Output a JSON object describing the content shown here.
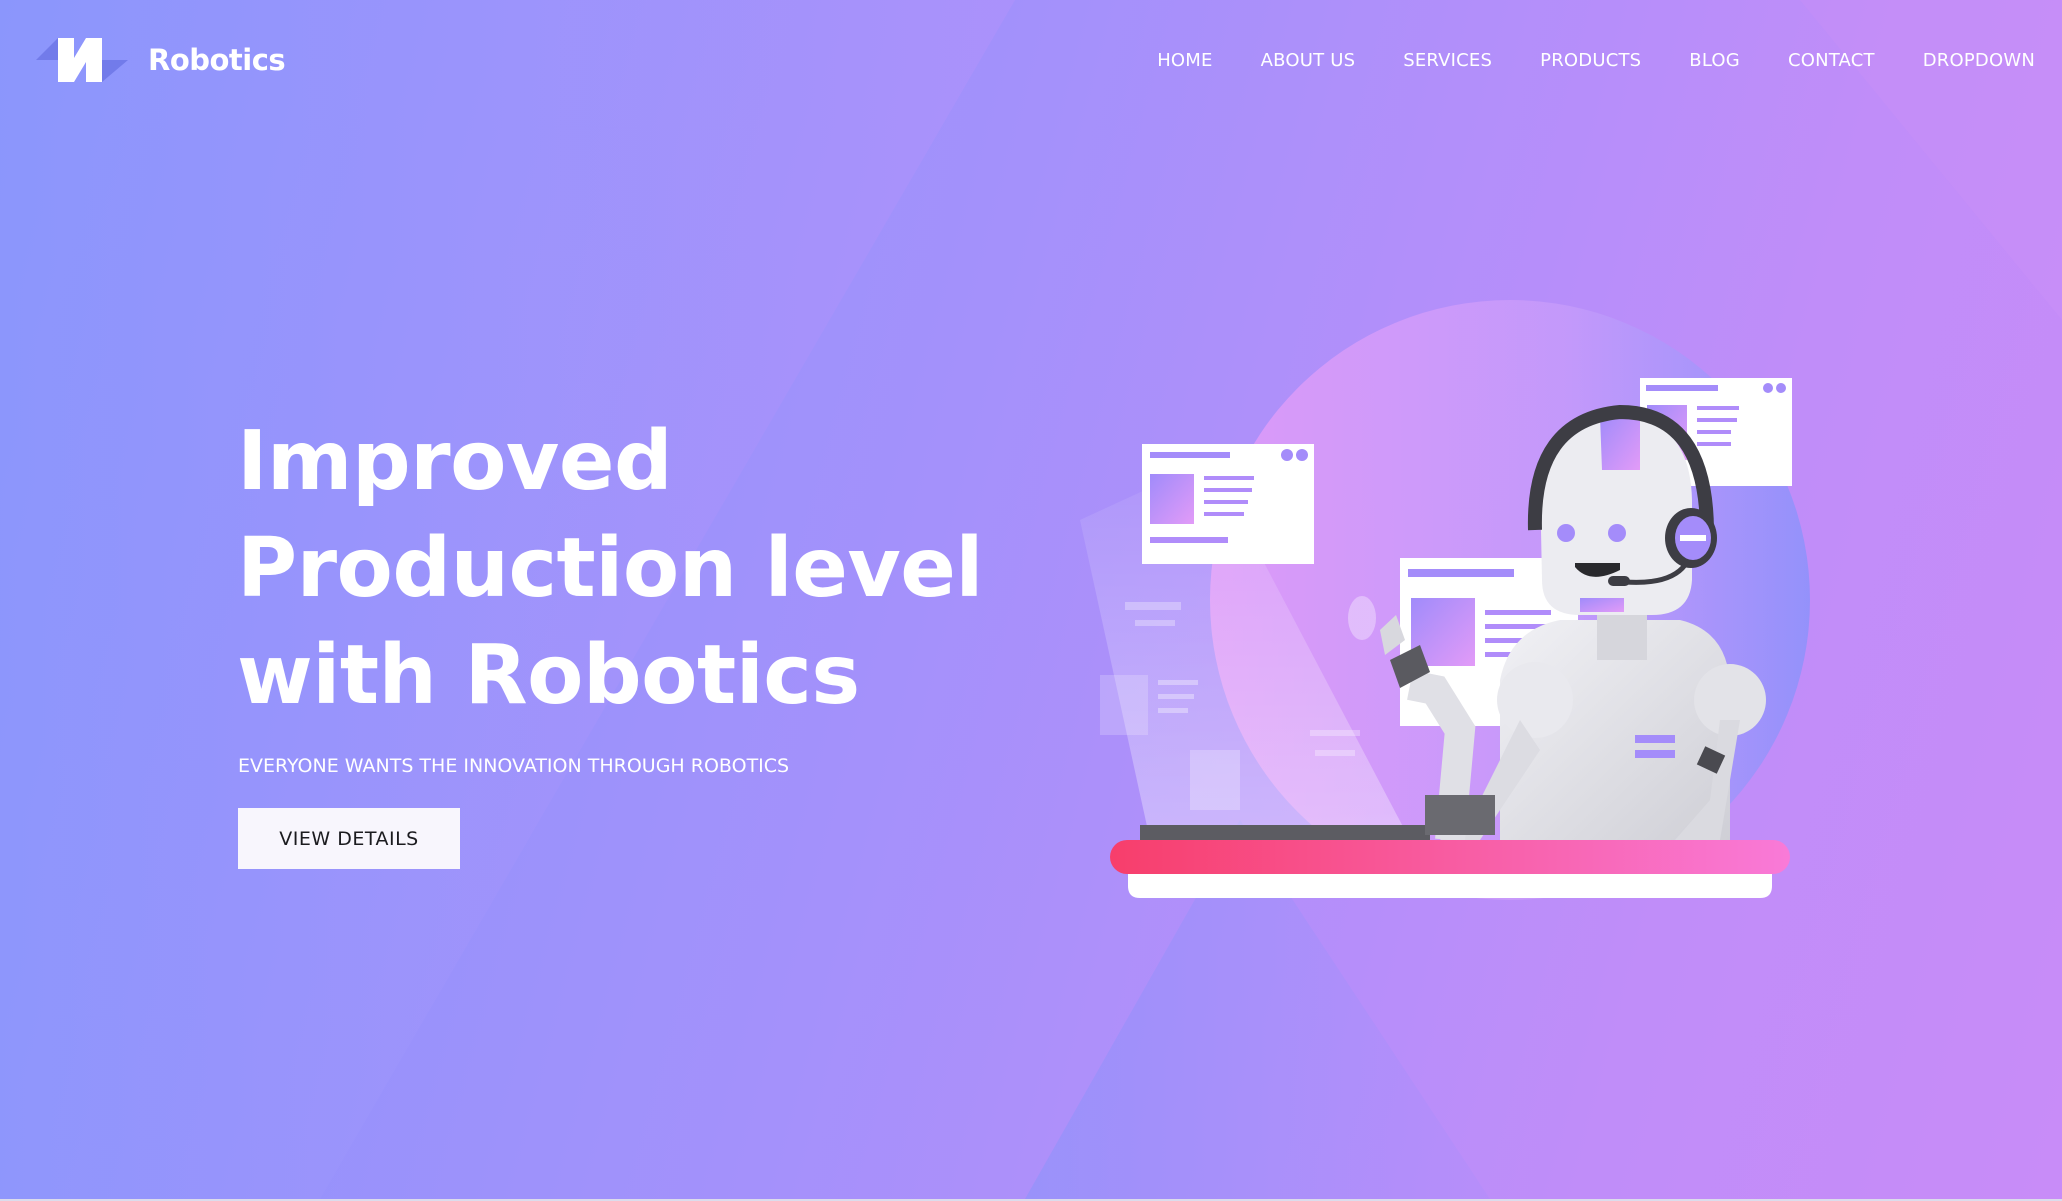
{
  "brand": {
    "name": "Robotics",
    "logo_icon": "robotics-logo-icon"
  },
  "nav": {
    "items": [
      "HOME",
      "ABOUT US",
      "SERVICES",
      "PRODUCTS",
      "BLOG",
      "CONTACT",
      "DROPDOWN"
    ]
  },
  "hero": {
    "headline": [
      "Improved",
      "Production level",
      "with Robotics"
    ],
    "subheadline": "EVERYONE WANTS THE INNOVATION THROUGH ROBOTICS",
    "cta_label": "VIEW DETAILS",
    "illustration_icon": "robot-with-headset-illustration"
  },
  "colors": {
    "gradient_start": "#8795fc",
    "gradient_end": "#c88cf8",
    "desk_stripe_start": "#f73e6b",
    "desk_stripe_end": "#f97ad8",
    "button_bg": "#f8f6fd"
  }
}
